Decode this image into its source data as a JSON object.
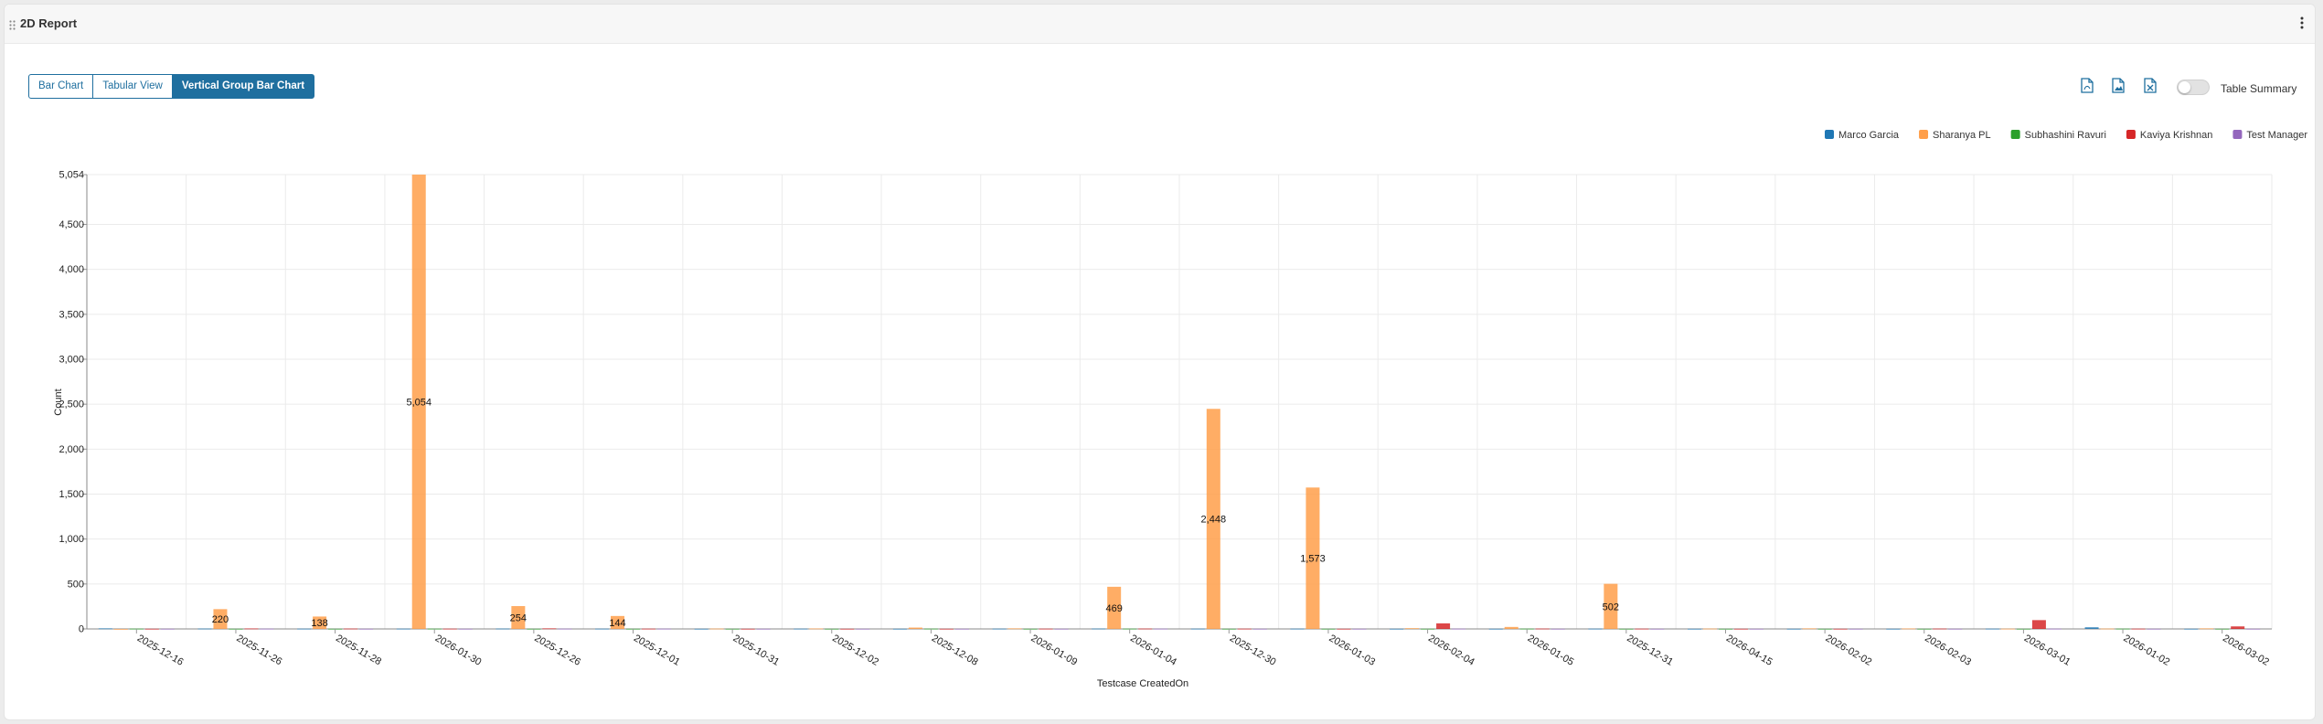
{
  "header": {
    "title": "2D Report"
  },
  "tabs": [
    {
      "label": "Bar Chart"
    },
    {
      "label": "Tabular View"
    },
    {
      "label": "Vertical Group Bar Chart"
    }
  ],
  "toolbar": {
    "table_summary_label": "Table Summary",
    "table_summary_on": false
  },
  "icons": {
    "drag": "drag-handle-icon",
    "menu": "more-vertical-icon",
    "pdf": "pdf-file-icon",
    "image": "image-file-icon",
    "excel": "excel-file-icon"
  },
  "colors": {
    "accent": "#1f6f9f"
  },
  "chart_data": {
    "type": "bar",
    "xlabel": "Testcase CreatedOn",
    "ylabel": "Count",
    "ylim": [
      0,
      5054
    ],
    "yticks": [
      0,
      500,
      1000,
      1500,
      2000,
      2500,
      3000,
      3500,
      4000,
      4500,
      5054
    ],
    "ytick_labels": [
      "0",
      "500",
      "1,000",
      "1,500",
      "2,000",
      "2,500",
      "3,000",
      "3,500",
      "4,000",
      "4,500",
      "5,054"
    ],
    "grid": true,
    "legend_position": "top-right",
    "categories": [
      "2025-12-16",
      "2025-11-26",
      "2025-11-28",
      "2026-01-30",
      "2025-12-26",
      "2025-12-01",
      "2025-10-31",
      "2025-12-02",
      "2025-12-08",
      "2026-01-09",
      "2026-01-04",
      "2025-12-30",
      "2026-01-03",
      "2026-02-04",
      "2026-01-05",
      "2025-12-31",
      "2026-04-15",
      "2026-02-02",
      "2026-02-03",
      "2026-03-01",
      "2026-01-02",
      "2026-03-02"
    ],
    "series": [
      {
        "name": "Marco Garcia",
        "color": "#1f77b4",
        "values": [
          6,
          4,
          3,
          3,
          4,
          3,
          2,
          3,
          2,
          3,
          4,
          3,
          3,
          2,
          2,
          3,
          2,
          2,
          2,
          3,
          18,
          2
        ]
      },
      {
        "name": "Sharanya PL",
        "color": "#ff9f4a",
        "values": [
          0,
          220,
          138,
          5054,
          254,
          144,
          4,
          5,
          15,
          6,
          469,
          2448,
          1573,
          8,
          22,
          502,
          4,
          6,
          5,
          3,
          4,
          6
        ]
      },
      {
        "name": "Subhashini Ravuri",
        "color": "#2ca02c",
        "values": [
          3,
          2,
          2,
          3,
          2,
          2,
          2,
          2,
          3,
          2,
          3,
          2,
          2,
          2,
          3,
          2,
          2,
          2,
          2,
          2,
          3,
          2
        ]
      },
      {
        "name": "Kaviya Krishnan",
        "color": "#d62728",
        "values": [
          2,
          5,
          4,
          3,
          6,
          3,
          2,
          2,
          2,
          3,
          4,
          3,
          2,
          62,
          4,
          3,
          2,
          2,
          4,
          98,
          3,
          28
        ]
      },
      {
        "name": "Test Manager",
        "color": "#9467bd",
        "values": [
          2,
          3,
          2,
          2,
          3,
          3,
          2,
          2,
          2,
          2,
          3,
          2,
          2,
          3,
          2,
          2,
          2,
          2,
          2,
          3,
          2,
          2
        ]
      }
    ],
    "data_labels": [
      {
        "category": "2025-11-26",
        "series": "Sharanya PL",
        "text": "220"
      },
      {
        "category": "2025-11-28",
        "series": "Sharanya PL",
        "text": "138"
      },
      {
        "category": "2026-01-30",
        "series": "Sharanya PL",
        "text": "5,054"
      },
      {
        "category": "2025-12-26",
        "series": "Sharanya PL",
        "text": "254"
      },
      {
        "category": "2025-12-01",
        "series": "Sharanya PL",
        "text": "144"
      },
      {
        "category": "2026-01-04",
        "series": "Sharanya PL",
        "text": "469"
      },
      {
        "category": "2025-12-30",
        "series": "Sharanya PL",
        "text": "2,448"
      },
      {
        "category": "2026-01-03",
        "series": "Sharanya PL",
        "text": "1,573"
      },
      {
        "category": "2025-12-31",
        "series": "Sharanya PL",
        "text": "502"
      }
    ]
  }
}
